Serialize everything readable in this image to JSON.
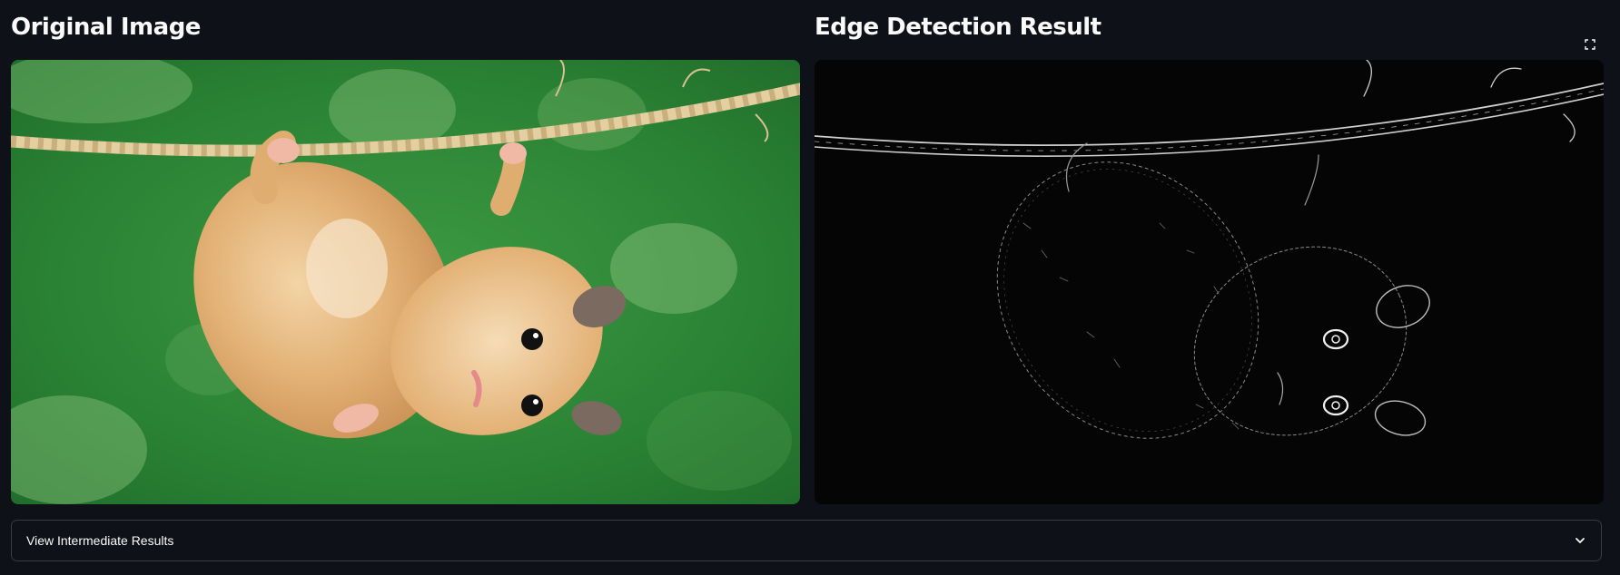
{
  "panels": {
    "original": {
      "title": "Original Image",
      "image_alt": "Hamster hanging from a rope against green background"
    },
    "edges": {
      "title": "Edge Detection Result",
      "image_alt": "Edge detection output of the hamster image"
    }
  },
  "toolbar": {
    "fullscreen_icon": "fullscreen-icon"
  },
  "expander": {
    "label": "View Intermediate Results",
    "icon": "chevron-down-icon"
  },
  "colors": {
    "background": "#0e1117",
    "text": "#fafafa",
    "border": "#3a3d48",
    "green_bg": "#2f8a3a",
    "fur": "#e3b37b"
  }
}
